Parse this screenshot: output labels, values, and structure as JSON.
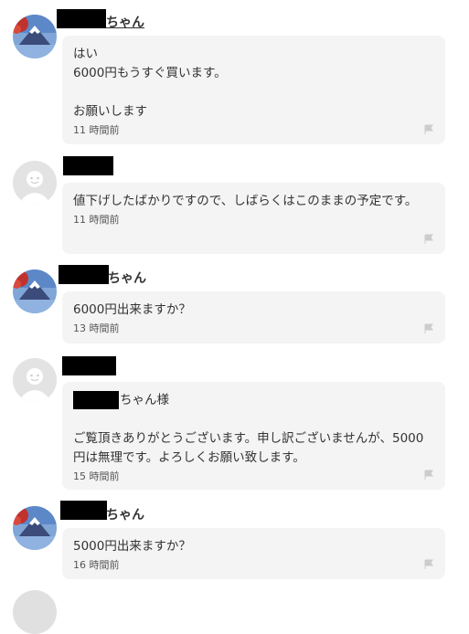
{
  "comments": [
    {
      "avatar": "mountain-photo-avatar",
      "name_suffix": "ちゃん",
      "body": "はい\n6000円もうすぐ買います。\n\nお願いします",
      "time": "11 時間前"
    },
    {
      "avatar": "default-user-avatar",
      "name_suffix": "",
      "body": "値下げしたばかりですので、しばらくはこのままの予定です。",
      "time": "11 時間前"
    },
    {
      "avatar": "mountain-photo-avatar",
      "name_suffix": "ちゃん",
      "body": "6000円出来ますか？",
      "time": "13 時間前"
    },
    {
      "avatar": "default-user-avatar",
      "name_suffix": "",
      "body_suffix": "ちゃん様",
      "body": "ご覧頂きありがとうございます。申し訳ございませんが、5000円は無理です。よろしくお願い致します。",
      "time": "15 時間前"
    },
    {
      "avatar": "mountain-photo-avatar",
      "name_suffix": "ちゃん",
      "body": "5000円出来ますか？",
      "time": "16 時間前"
    }
  ],
  "icons": {
    "flag": "flag-icon",
    "colors": {
      "bubble": "#f4f4f4",
      "flag": "#cccccc",
      "default_avatar": "#e0e0e0"
    }
  }
}
